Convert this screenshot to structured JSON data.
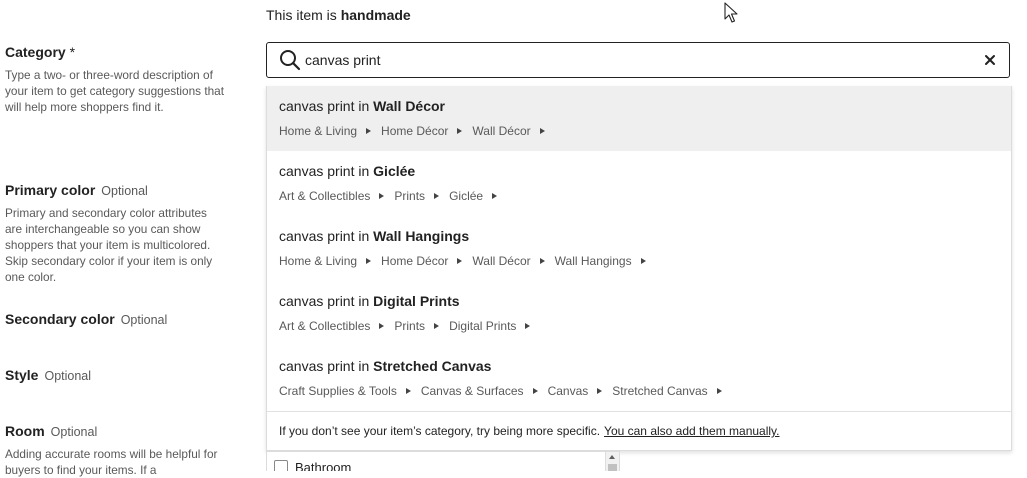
{
  "handmade": {
    "prefix": "This item is ",
    "bold": "handmade"
  },
  "fields": {
    "category": {
      "label": "Category",
      "required_mark": " *",
      "description": "Type a two- or three-word description of your item to get category suggestions that will help more shoppers find it."
    },
    "primary_color": {
      "label": "Primary color",
      "optional": "Optional",
      "description": "Primary and secondary color attributes are interchangeable so you can show shoppers that your item is multicolored. Skip secondary color if your item is only one color."
    },
    "secondary_color": {
      "label": "Secondary color",
      "optional": "Optional"
    },
    "style": {
      "label": "Style",
      "optional": "Optional"
    },
    "room": {
      "label": "Room",
      "optional": "Optional",
      "description": "Adding accurate rooms will be helpful for buyers to find your items. If a"
    }
  },
  "search": {
    "value": "canvas print"
  },
  "suggestions": [
    {
      "prefix": "canvas print in ",
      "category": "Wall Décor",
      "path": [
        "Home & Living",
        "Home Décor",
        "Wall Décor"
      ]
    },
    {
      "prefix": "canvas print in ",
      "category": "Giclée",
      "path": [
        "Art & Collectibles",
        "Prints",
        "Giclée"
      ]
    },
    {
      "prefix": "canvas print in ",
      "category": "Wall Hangings",
      "path": [
        "Home & Living",
        "Home Décor",
        "Wall Décor",
        "Wall Hangings"
      ]
    },
    {
      "prefix": "canvas print in ",
      "category": "Digital Prints",
      "path": [
        "Art & Collectibles",
        "Prints",
        "Digital Prints"
      ]
    },
    {
      "prefix": "canvas print in ",
      "category": "Stretched Canvas",
      "path": [
        "Craft Supplies & Tools",
        "Canvas & Surfaces",
        "Canvas",
        "Stretched Canvas"
      ]
    }
  ],
  "footer": {
    "text": "If you don’t see your item’s category, try being more specific.",
    "link": "You can also add them manually."
  },
  "room_options": [
    "Bathroom"
  ],
  "colors": {
    "border_dark": "#222222",
    "active_row": "#efefef",
    "muted_text": "#595959"
  }
}
